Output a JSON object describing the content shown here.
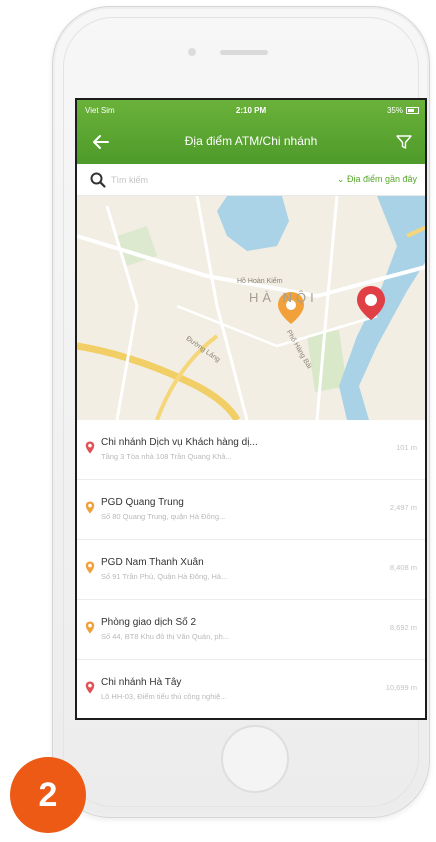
{
  "status_bar": {
    "carrier": "Viet Sim",
    "time": "2:10 PM",
    "battery": "35%"
  },
  "header": {
    "title": "Địa điểm ATM/Chi nhánh",
    "accent_color": "#5aa632"
  },
  "search": {
    "placeholder": "Tìm kiếm",
    "recent_label": "Địa điểm gần đây"
  },
  "map": {
    "labels": {
      "city": "HÀ NỘI",
      "road1": "Phố Hàng Bài",
      "road2": "Đường Láng",
      "lake": "Hồ Hoàn Kiếm"
    },
    "markers": [
      "pin-yellow",
      "pin-red"
    ]
  },
  "locations": [
    {
      "name": "Chi nhánh Dịch vụ Khách hàng dị...",
      "address": "Tầng 3 Tòa nhà 108 Trần Quang Khả...",
      "distance": "101 m",
      "pin_color": "#e05055"
    },
    {
      "name": "PGD Quang Trung",
      "address": "Số 80 Quang Trung, quận Hà Đông...",
      "distance": "2,497 m",
      "pin_color": "#f2a13a"
    },
    {
      "name": "PGD Nam Thanh Xuân",
      "address": "Số 91 Trần Phú, Quận Hà Đông, Hà...",
      "distance": "8,408 m",
      "pin_color": "#f2a13a"
    },
    {
      "name": "Phòng giao dịch Số 2",
      "address": "Số 44, BT8 Khu đô thị Văn Quán, ph...",
      "distance": "8,692 m",
      "pin_color": "#f2a13a"
    },
    {
      "name": "Chi nhánh Hà Tây",
      "address": "Lô HH-03, Điểm tiểu thủ công nghiệ...",
      "distance": "10,699 m",
      "pin_color": "#e05055"
    }
  ],
  "step_badge": {
    "number": "2",
    "color": "#ec5a16"
  }
}
